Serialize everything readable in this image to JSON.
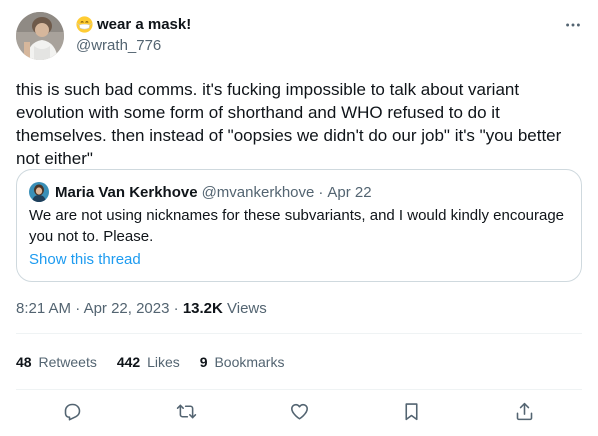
{
  "author": {
    "display_name": "wear a mask!",
    "handle": "@wrath_776"
  },
  "tweet": {
    "text": "this is such bad comms. it's fucking impossible to talk about variant evolution with some form of shorthand and WHO refused to do it themselves. then instead of \"oopsies we didn't do our job\" it's \"you better not either\""
  },
  "quote": {
    "name": "Maria Van Kerkhove",
    "handle": "@mvankerkhove",
    "dot": "·",
    "date": "Apr 22",
    "text": "We are not using nicknames for these subvariants, and I would kindly encourage you not to. Please.",
    "link": "Show this thread"
  },
  "meta": {
    "time": "8:21 AM",
    "dot1": "·",
    "date": "Apr 22, 2023",
    "dot2": "·",
    "views_count": "13.2K",
    "views_label": "Views"
  },
  "stats": {
    "retweets_count": "48",
    "retweets_label": "Retweets",
    "likes_count": "442",
    "likes_label": "Likes",
    "bookmarks_count": "9",
    "bookmarks_label": "Bookmarks"
  },
  "icons": {
    "more": "more-horizontal-icon",
    "reply": "reply-icon",
    "retweet": "retweet-icon",
    "like": "heart-icon",
    "bookmark": "bookmark-icon",
    "share": "share-icon"
  },
  "colors": {
    "text": "#0f1419",
    "secondary": "#536471",
    "link": "#1d9bf0",
    "border": "#cfd9de"
  }
}
